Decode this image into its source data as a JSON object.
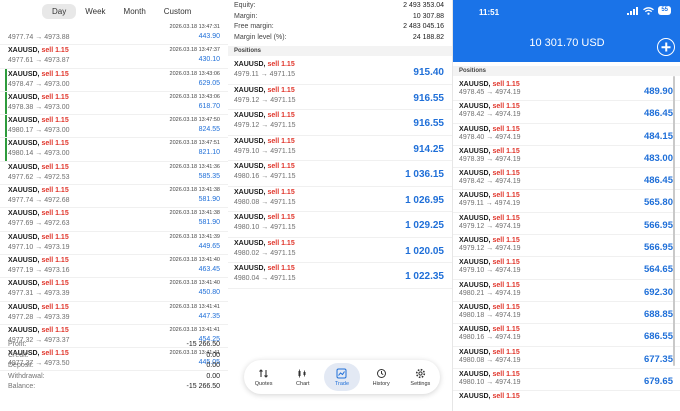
{
  "history": {
    "periods": [
      "Day",
      "Week",
      "Month",
      "Custom"
    ],
    "rows": [
      {
        "title": "",
        "side": "",
        "prices": "4977.74 → 4973.88",
        "date": "2026.03.18 13:47:31",
        "profit": "443.90",
        "marked": false
      },
      {
        "title": "XAUUSD,",
        "side": "sell 1.15",
        "prices": "4977.61 → 4973.87",
        "date": "2026.03.18 13:47:37",
        "profit": "430.10",
        "marked": false
      },
      {
        "title": "XAUUSD,",
        "side": "sell 1.15",
        "prices": "4978.47 → 4973.00",
        "date": "2026.03.18 13:43:06",
        "profit": "629.05",
        "marked": true
      },
      {
        "title": "XAUUSD,",
        "side": "sell 1.15",
        "prices": "4978.38 → 4973.00",
        "date": "2026.03.18 13:43:06",
        "profit": "618.70",
        "marked": true
      },
      {
        "title": "XAUUSD,",
        "side": "sell 1.15",
        "prices": "4980.17 → 4973.00",
        "date": "2026.03.18 13:47:50",
        "profit": "824.55",
        "marked": true
      },
      {
        "title": "XAUUSD,",
        "side": "sell 1.15",
        "prices": "4980.14 → 4973.00",
        "date": "2026.03.18 13:47:51",
        "profit": "821.10",
        "marked": true
      },
      {
        "title": "XAUUSD,",
        "side": "sell 1.15",
        "prices": "4977.62 → 4972.53",
        "date": "2026.03.18 13:41:36",
        "profit": "585.35",
        "marked": false
      },
      {
        "title": "XAUUSD,",
        "side": "sell 1.15",
        "prices": "4977.74 → 4972.68",
        "date": "2026.03.18 13:41:38",
        "profit": "581.90",
        "marked": false
      },
      {
        "title": "XAUUSD,",
        "side": "sell 1.15",
        "prices": "4977.69 → 4972.63",
        "date": "2026.03.18 13:41:38",
        "profit": "581.90",
        "marked": false
      },
      {
        "title": "XAUUSD,",
        "side": "sell 1.15",
        "prices": "4977.10 → 4973.19",
        "date": "2026.03.18 13:41:39",
        "profit": "449.65",
        "marked": false
      },
      {
        "title": "XAUUSD,",
        "side": "sell 1.15",
        "prices": "4977.19 → 4973.16",
        "date": "2026.03.18 13:41:40",
        "profit": "463.45",
        "marked": false
      },
      {
        "title": "XAUUSD,",
        "side": "sell 1.15",
        "prices": "4977.31 → 4973.39",
        "date": "2026.03.18 13:41:40",
        "profit": "450.80",
        "marked": false
      },
      {
        "title": "XAUUSD,",
        "side": "sell 1.15",
        "prices": "4977.28 → 4973.39",
        "date": "2026.03.18 13:41:41",
        "profit": "447.35",
        "marked": false
      },
      {
        "title": "XAUUSD,",
        "side": "sell 1.15",
        "prices": "4977.32 → 4973.37",
        "date": "2026.03.18 13:41:41",
        "profit": "454.25",
        "marked": false
      },
      {
        "title": "XAUUSD,",
        "side": "sell 1.15",
        "prices": "4977.37 → 4973.50",
        "date": "2026.03.18 13:41:41",
        "profit": "445.05",
        "marked": false
      }
    ],
    "summary": [
      {
        "label": "Profit:",
        "value": "-15 266.50"
      },
      {
        "label": "Credit:",
        "value": "0.00"
      },
      {
        "label": "Deposit:",
        "value": "0.00"
      },
      {
        "label": "Withdrawal:",
        "value": "0.00"
      },
      {
        "label": "Balance:",
        "value": "-15 266.50"
      }
    ]
  },
  "trade": {
    "account": [
      {
        "label": "Equity:",
        "value": "2 493 353.04"
      },
      {
        "label": "Margin:",
        "value": "10 307.88"
      },
      {
        "label": "Free margin:",
        "value": "2 483 045.16"
      },
      {
        "label": "Margin level (%):",
        "value": "24 188.82"
      }
    ],
    "positions_header": "Positions",
    "positions": [
      {
        "title": "XAUUSD,",
        "side": "sell 1.15",
        "prices": "4979.11 → 4971.15",
        "profit": "915.40"
      },
      {
        "title": "XAUUSD,",
        "side": "sell 1.15",
        "prices": "4979.12 → 4971.15",
        "profit": "916.55"
      },
      {
        "title": "XAUUSD,",
        "side": "sell 1.15",
        "prices": "4979.12 → 4971.15",
        "profit": "916.55"
      },
      {
        "title": "XAUUSD,",
        "side": "sell 1.15",
        "prices": "4979.10 → 4971.15",
        "profit": "914.25"
      },
      {
        "title": "XAUUSD,",
        "side": "sell 1.15",
        "prices": "4980.16 → 4971.15",
        "profit": "1 036.15"
      },
      {
        "title": "XAUUSD,",
        "side": "sell 1.15",
        "prices": "4980.08 → 4971.15",
        "profit": "1 026.95"
      },
      {
        "title": "XAUUSD,",
        "side": "sell 1.15",
        "prices": "4980.10 → 4971.15",
        "profit": "1 029.25"
      },
      {
        "title": "XAUUSD,",
        "side": "sell 1.15",
        "prices": "4980.02 → 4971.15",
        "profit": "1 020.05"
      },
      {
        "title": "XAUUSD,",
        "side": "sell 1.15",
        "prices": "4980.04 → 4971.15",
        "profit": "1 022.35"
      }
    ],
    "nav": [
      {
        "label": "Quotes",
        "icon": "quotes-icon",
        "active": false
      },
      {
        "label": "Chart",
        "icon": "chart-icon",
        "active": false
      },
      {
        "label": "Trade",
        "icon": "trade-icon",
        "active": true
      },
      {
        "label": "History",
        "icon": "history-icon",
        "active": false
      },
      {
        "label": "Settings",
        "icon": "settings-icon",
        "active": false
      }
    ]
  },
  "mobile": {
    "time": "11:51",
    "battery": "55",
    "balance": "10 301.70 USD",
    "positions_header": "Positions",
    "positions": [
      {
        "title": "XAUUSD,",
        "side": "sell 1.15",
        "prices": "4978.45 → 4974.19",
        "profit": "489.90"
      },
      {
        "title": "XAUUSD,",
        "side": "sell 1.15",
        "prices": "4978.42 → 4974.19",
        "profit": "486.45"
      },
      {
        "title": "XAUUSD,",
        "side": "sell 1.15",
        "prices": "4978.40 → 4974.19",
        "profit": "484.15"
      },
      {
        "title": "XAUUSD,",
        "side": "sell 1.15",
        "prices": "4978.39 → 4974.19",
        "profit": "483.00"
      },
      {
        "title": "XAUUSD,",
        "side": "sell 1.15",
        "prices": "4978.42 → 4974.19",
        "profit": "486.45"
      },
      {
        "title": "XAUUSD,",
        "side": "sell 1.15",
        "prices": "4979.11 → 4974.19",
        "profit": "565.80"
      },
      {
        "title": "XAUUSD,",
        "side": "sell 1.15",
        "prices": "4979.12 → 4974.19",
        "profit": "566.95"
      },
      {
        "title": "XAUUSD,",
        "side": "sell 1.15",
        "prices": "4979.12 → 4974.19",
        "profit": "566.95"
      },
      {
        "title": "XAUUSD,",
        "side": "sell 1.15",
        "prices": "4979.10 → 4974.19",
        "profit": "564.65"
      },
      {
        "title": "XAUUSD,",
        "side": "sell 1.15",
        "prices": "4980.21 → 4974.19",
        "profit": "692.30"
      },
      {
        "title": "XAUUSD,",
        "side": "sell 1.15",
        "prices": "4980.18 → 4974.19",
        "profit": "688.85"
      },
      {
        "title": "XAUUSD,",
        "side": "sell 1.15",
        "prices": "4980.16 → 4974.19",
        "profit": "686.55"
      },
      {
        "title": "XAUUSD,",
        "side": "sell 1.15",
        "prices": "4980.08 → 4974.19",
        "profit": "677.35"
      },
      {
        "title": "XAUUSD,",
        "side": "sell 1.15",
        "prices": "4980.10 → 4974.19",
        "profit": "679.65"
      },
      {
        "title": "XAUUSD,",
        "side": "sell 1.15",
        "prices": "",
        "profit": ""
      }
    ]
  }
}
